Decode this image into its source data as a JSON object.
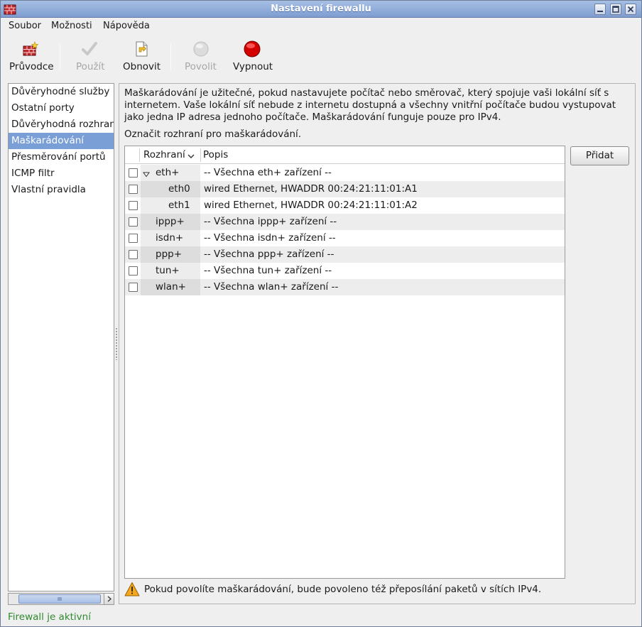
{
  "window": {
    "title": "Nastavení firewallu"
  },
  "menu": [
    "Soubor",
    "Možnosti",
    "Nápověda"
  ],
  "toolbar": {
    "wizard": "Průvodce",
    "apply": "Použít",
    "reload": "Obnovit",
    "enable": "Povolit",
    "disable": "Vypnout"
  },
  "categories": [
    "Důvěryhodné služby",
    "Ostatní porty",
    "Důvěryhodná rozhraní",
    "Maškarádování",
    "Přesměrování portů",
    "ICMP filtr",
    "Vlastní pravidla"
  ],
  "selected_category": "Maškarádování",
  "content": {
    "description": "Maškarádování je užitečné, pokud nastavujete počítač nebo směrovač, který spojuje vaši lokální síť s internetem. Vaše lokální síť nebude z internetu dostupná a všechny vnitřní počítače budou vystupovat jako jedna IP adresa jednoho počítače. Maškarádování funguje pouze pro IPv4.",
    "mark_label": "Označit rozhraní pro maškarádování.",
    "columns": {
      "interface": "Rozhraní",
      "description": "Popis"
    },
    "rows": [
      {
        "iface": "eth+",
        "desc": "-- Všechna eth+ zařízení --",
        "checked": false,
        "expanded": true
      },
      {
        "iface": "eth0",
        "desc": "wired Ethernet, HWADDR 00:24:21:11:01:A1",
        "checked": false
      },
      {
        "iface": "eth1",
        "desc": "wired Ethernet, HWADDR 00:24:21:11:01:A2",
        "checked": false
      },
      {
        "iface": "ippp+",
        "desc": "-- Všechna ippp+ zařízení --",
        "checked": false
      },
      {
        "iface": "isdn+",
        "desc": "-- Všechna isdn+ zařízení --",
        "checked": false
      },
      {
        "iface": "ppp+",
        "desc": "-- Všechna ppp+ zařízení --",
        "checked": false
      },
      {
        "iface": "tun+",
        "desc": "-- Všechna tun+ zařízení --",
        "checked": false
      },
      {
        "iface": "wlan+",
        "desc": "-- Všechna wlan+ zařízení --",
        "checked": false
      }
    ],
    "add_button": "Přidat",
    "warning": "Pokud povolíte maškarádování, bude povoleno též přeposílání paketů v sítích IPv4."
  },
  "status": "Firewall je aktivní",
  "colors": {
    "selection": "#7a9fd7",
    "status_ok": "#2f8a2f",
    "title_bar": "#8fabd9"
  }
}
